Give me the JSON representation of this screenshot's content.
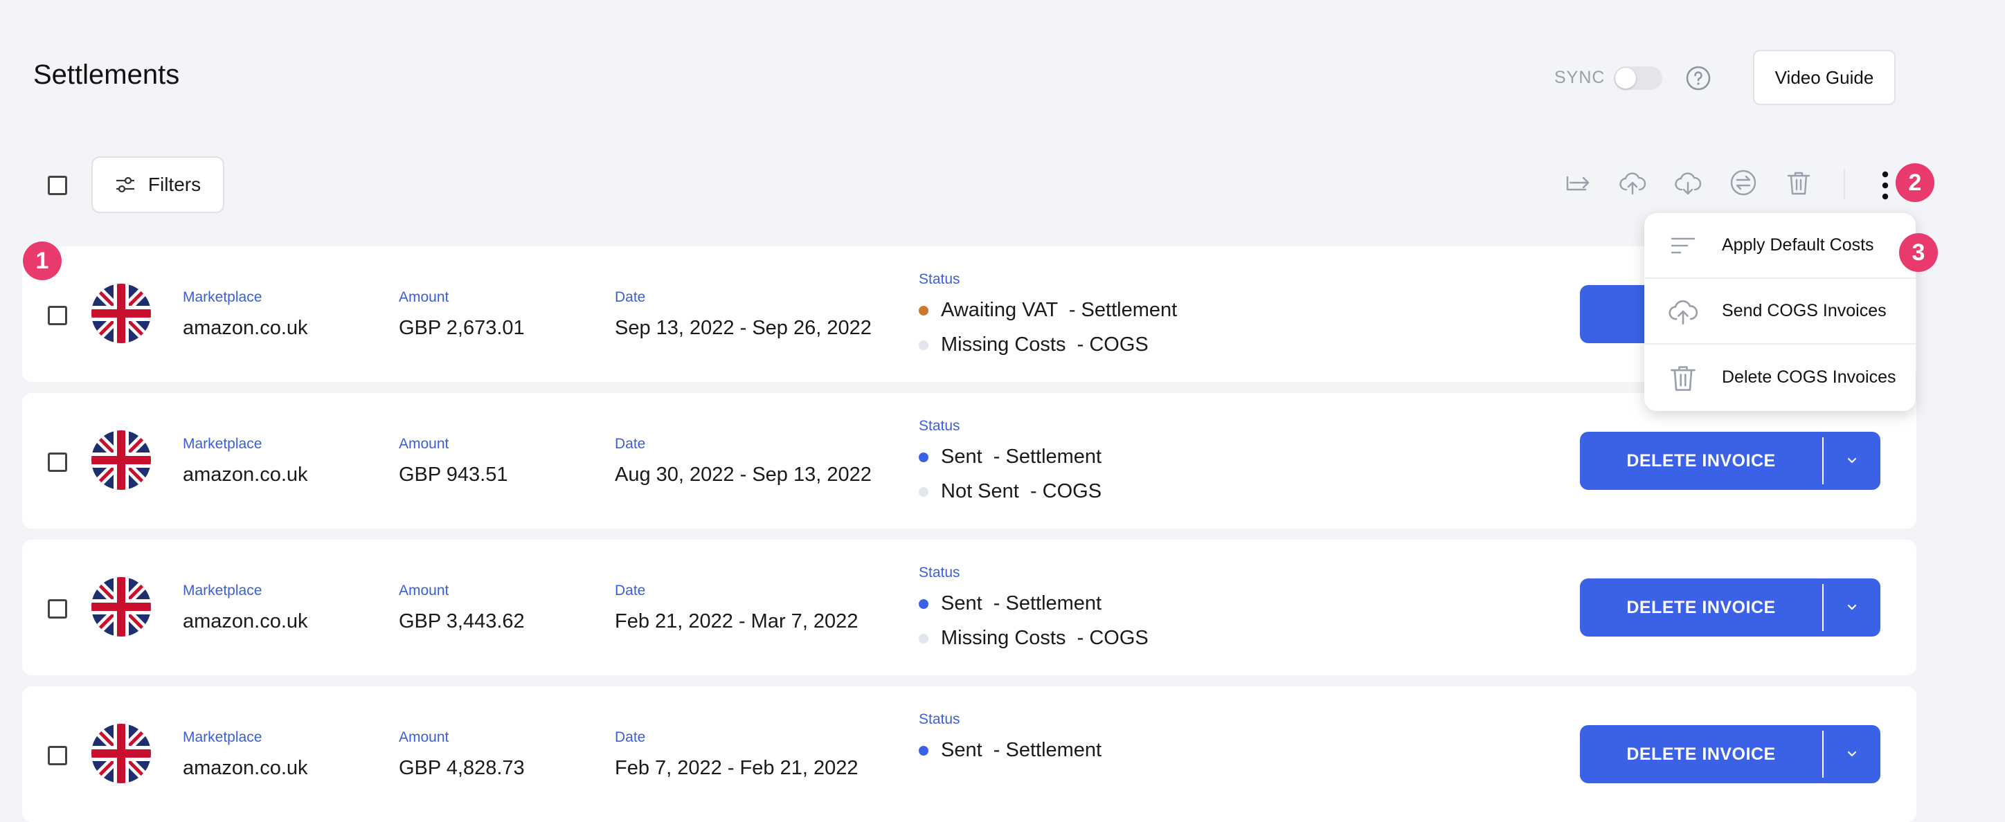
{
  "header": {
    "title": "Settlements",
    "sync_label": "SYNC",
    "video_guide_label": "Video Guide"
  },
  "toolbar": {
    "filters_label": "Filters",
    "icons": [
      "forward-icon",
      "cloud-upload-icon",
      "cloud-download-icon",
      "swap-icon",
      "trash-icon",
      "more-vertical-icon"
    ]
  },
  "annotations": {
    "badge_1": "1",
    "badge_2": "2",
    "badge_3": "3"
  },
  "labels": {
    "marketplace": "Marketplace",
    "amount": "Amount",
    "date": "Date",
    "status": "Status"
  },
  "colors": {
    "accent": "#3b62e6",
    "status_awaiting": "#c9782d",
    "status_sent": "#3b62e6",
    "status_idle": "#e3e6ee",
    "badge": "#e83a6c"
  },
  "rows": [
    {
      "marketplace": "amazon.co.uk",
      "amount": "GBP 2,673.01",
      "date": "Sep 13, 2022 - Sep 26, 2022",
      "status1": "Awaiting VAT  - Settlement",
      "status2": "Missing Costs  - COGS",
      "action": "SEND"
    },
    {
      "marketplace": "amazon.co.uk",
      "amount": "GBP 943.51",
      "date": "Aug 30, 2022 - Sep 13, 2022",
      "status1": "Sent  - Settlement",
      "status2": "Not Sent  - COGS",
      "action": "DELETE INVOICE"
    },
    {
      "marketplace": "amazon.co.uk",
      "amount": "GBP 3,443.62",
      "date": "Feb 21, 2022 - Mar 7, 2022",
      "status1": "Sent  - Settlement",
      "status2": "Missing Costs  - COGS",
      "action": "DELETE INVOICE"
    },
    {
      "marketplace": "amazon.co.uk",
      "amount": "GBP 4,828.73",
      "date": "Feb 7, 2022 - Feb 21, 2022",
      "status1": "Sent  - Settlement",
      "status2": "",
      "action": "DELETE INVOICE"
    }
  ],
  "menu": {
    "items": [
      {
        "label": "Apply Default Costs",
        "icon": "sort-lines-icon"
      },
      {
        "label": "Send COGS Invoices",
        "icon": "cloud-upload-icon"
      },
      {
        "label": "Delete COGS Invoices",
        "icon": "trash-icon"
      }
    ]
  }
}
